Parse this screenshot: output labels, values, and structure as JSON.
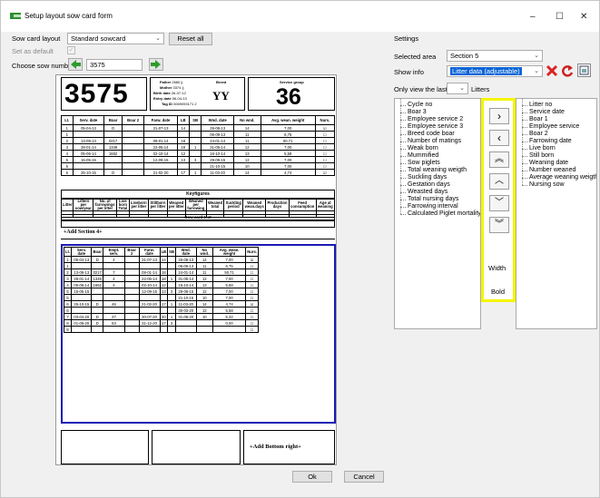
{
  "window": {
    "title": "Setup layout sow card form",
    "minimize": "–",
    "maximize": "☐",
    "close": "✕"
  },
  "left": {
    "sow_card_layout_label": "Sow card layout",
    "sow_card_layout_value": "Standard sowcard",
    "reset_all": "Reset all",
    "set_as_default": "Set as default",
    "choose_sow_label": "Choose sow number",
    "sow_number": "3575"
  },
  "card": {
    "sow_number": "3575",
    "father_label": "Father",
    "father_value": "2680 ||",
    "mother_label": "Mother",
    "mother_value": "3374 ||",
    "birth_label": "Birth date",
    "birth_value": "26-07-12",
    "entry_label": "Entry date",
    "entry_value": "06-04-13",
    "tag_label": "Tag ID",
    "tag_value": "0069093171 2",
    "breed_label": "Breed",
    "breed_value": "YY",
    "service_group_label": "Service group",
    "service_group_value": "36",
    "headers": [
      "Lt.",
      "Serv. date",
      "Boar",
      "Boar 2",
      "Farw. date",
      "LB",
      "SB",
      "Wnd. date",
      "No wnd.",
      "Avg. wean. weight",
      "Nurs."
    ],
    "rows": [
      [
        "1",
        "05-04-13",
        "D",
        "",
        "31-07-13",
        "14",
        "",
        "26-08-13",
        "14",
        "7,00",
        "☑"
      ],
      [
        "1",
        "",
        "",
        "",
        "",
        "",
        "",
        "06-09-13",
        "11",
        "6,75",
        "☐"
      ],
      [
        "2",
        "13-09-13",
        "0217",
        "",
        "08-01-14",
        "18",
        "",
        "24-01-14",
        "11",
        "50,71",
        "☐"
      ],
      [
        "3",
        "28-01-14",
        "1349",
        "",
        "22-05-14",
        "18",
        "1",
        "31-05-14",
        "12",
        "7,00",
        "☐"
      ],
      [
        "4",
        "05-06-14",
        "1662",
        "",
        "02-10-14",
        "12",
        "",
        "16-10-14",
        "13",
        "5,58",
        "☐"
      ],
      [
        "5",
        "15-05-15",
        "",
        "",
        "12-09-15",
        "13",
        "3",
        "29-09-15",
        "12",
        "7,00",
        "☐"
      ],
      [
        "5",
        "",
        "",
        "",
        "",
        "",
        "",
        "21-10-15",
        "10",
        "7,00",
        "☐"
      ],
      [
        "6",
        "25-10-15",
        "D",
        "",
        "21-02-20",
        "17",
        "1",
        "11-03-20",
        "14",
        "4,74",
        "☑"
      ]
    ],
    "keyfigures_title": "Keyfigures",
    "keyfigure_headers": [
      "Litter",
      "Litters per sow/year",
      "No. of farrowings per litter",
      "Live born Total",
      "Liveborn per litter",
      "Stillborn per litter",
      "Weaned per litter",
      "Weaned per farrowing",
      "Weaned total",
      "Suckling period",
      "Weaned wean.days",
      "Production days",
      "Feed consumption",
      "Age at weaning"
    ],
    "text_title": "Sow card text",
    "add_section": "+Add Section 4+",
    "sec_headers": [
      "Lt.",
      "Serv. date",
      "Boar",
      "Empt. serv.",
      "Boar 2",
      "Farw. date",
      "LB",
      "SB",
      "Wnd. date",
      "No wnd.",
      "Avg. wean. weight",
      "Nurs."
    ],
    "sec_rows": [
      [
        "1",
        "05-04-13",
        "D",
        "4",
        "",
        "31-07-13",
        "14",
        "",
        "26-08-13",
        "14",
        "7,00",
        "☑"
      ],
      [
        "1",
        "",
        "",
        "",
        "",
        "",
        "",
        "",
        "06-09-13",
        "11",
        "6,75",
        "☐"
      ],
      [
        "2",
        "13-09-13",
        "0217",
        "7",
        "",
        "08-01-14",
        "18",
        "",
        "24-01-14",
        "11",
        "50,71",
        "☐"
      ],
      [
        "3",
        "28-01-14",
        "1349",
        "4",
        "",
        "22-05-14",
        "18",
        "1",
        "31-05-14",
        "12",
        "7,00",
        "☐"
      ],
      [
        "4",
        "05-06-14",
        "1662",
        "4",
        "",
        "02-10-14",
        "12",
        "",
        "16-10-14",
        "13",
        "5,58",
        "☐"
      ],
      [
        "5",
        "15-05-15",
        "",
        "",
        "",
        "12-09-15",
        "13",
        "3",
        "29-09-15",
        "12",
        "7,00",
        "☐"
      ],
      [
        "5",
        "",
        "",
        "",
        "",
        "",
        "",
        "",
        "21-10-15",
        "10",
        "7,00",
        "☐"
      ],
      [
        "6",
        "25-10-15",
        "D",
        "46",
        "",
        "21-02-20",
        "17",
        "1",
        "11-03-20",
        "14",
        "4,74",
        "☑"
      ],
      [
        "6",
        "",
        "",
        "",
        "",
        "",
        "",
        "",
        "30-03-20",
        "12",
        "5,58",
        "☐"
      ],
      [
        "7",
        "03-04-20",
        "D",
        "27",
        "",
        "30-07-20",
        "20",
        "1",
        "31-08-20",
        "10",
        "5,32",
        "☐"
      ],
      [
        "8",
        "01-09-20",
        "D",
        "63",
        "",
        "31-12-20",
        "17",
        "3",
        "",
        "",
        "0,00",
        "☐"
      ],
      [
        "8",
        "",
        "",
        "",
        "",
        "",
        "",
        "",
        "",
        "",
        "",
        "☐"
      ]
    ],
    "add_bottom_right": "+Add Bottom right+"
  },
  "buttons": {
    "ok": "Ok",
    "cancel": "Cancel"
  },
  "settings": {
    "title": "Settings",
    "selected_area_label": "Selected area",
    "selected_area_value": "Section 5",
    "show_info_label": "Show info",
    "show_info_value": "Litter data (adjustable)",
    "only_view_label": "Only view the last",
    "litters_label": "Litters",
    "available_items": [
      "Cycle no",
      "Boar 3",
      "Employee service 2",
      "Employee service 3",
      "Breed code boar",
      "Number of matings",
      "Weak born",
      "Mummified",
      "Sow piglets",
      "Total weaning weigth",
      "Suckling days",
      "Gestation days",
      "Weasted days",
      "Total nursing days",
      "Farrowing interval",
      "Calculated Piglet mortality"
    ],
    "selected_items": [
      "Litter no",
      "Service date",
      "Boar 1",
      "Employee service",
      "Boar 2",
      "Farrowing date",
      "Live born",
      "Still born",
      "Weaning date",
      "Number weaned",
      "Average weaning weigth",
      "Nursing sow"
    ],
    "width_label": "Width",
    "bold_label": "Bold"
  }
}
